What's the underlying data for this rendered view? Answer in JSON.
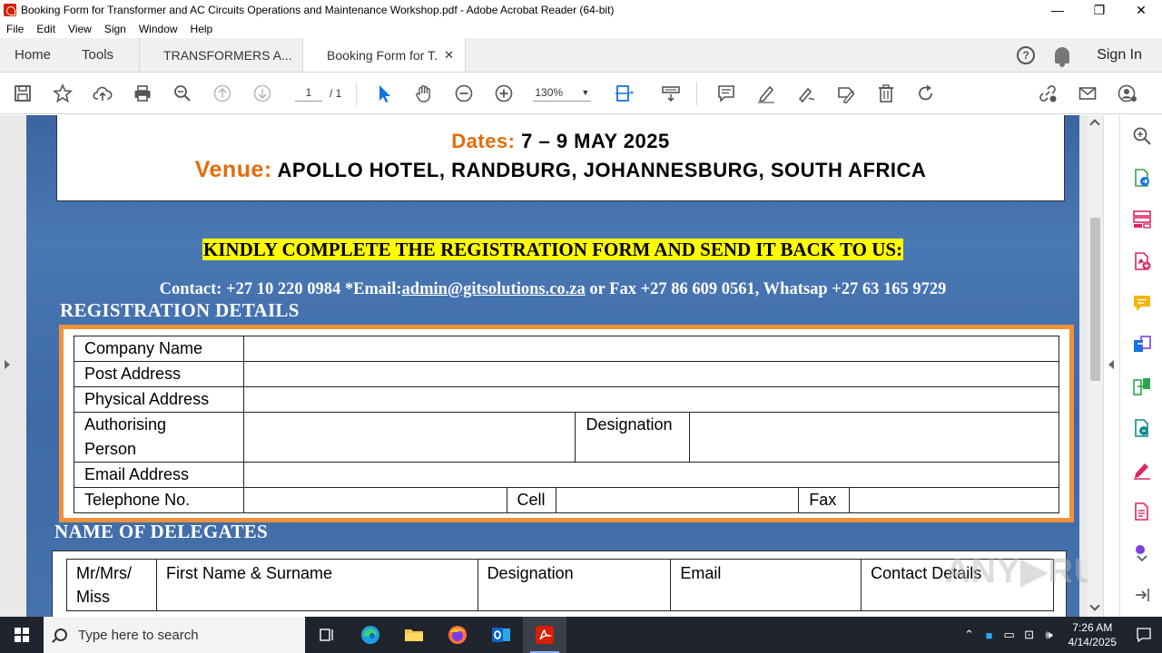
{
  "window": {
    "title": "Booking Form for Transformer and AC Circuits Operations and Maintenance Workshop.pdf - Adobe Acrobat Reader (64-bit)",
    "min": "—",
    "max": "❐",
    "close": "✕"
  },
  "menu": [
    "File",
    "Edit",
    "View",
    "Sign",
    "Window",
    "Help"
  ],
  "tabs": {
    "home": "Home",
    "tools": "Tools",
    "doc1": "TRANSFORMERS A...",
    "doc2": "Booking Form for T...",
    "close": "✕",
    "help": "?",
    "signin": "Sign In"
  },
  "toolbar": {
    "page_current": "1",
    "page_total": "/  1",
    "zoom": "130%"
  },
  "document": {
    "dates_label": "Dates:",
    "dates_value": "7 – 9 MAY 2025",
    "venue_label": "Venue:",
    "venue_value": "APOLLO HOTEL, RANDBURG, JOHANNESBURG, SOUTH AFRICA",
    "kindly": "KINDLY COMPLETE THE REGISTRATION FORM AND SEND IT BACK TO US:",
    "contact_prefix": "Contact: +27 10 220 0984 *Email:",
    "contact_email": "admin@gitsolutions.co.za",
    "contact_suffix": " or Fax +27 86 609 0561, Whatsap +27 63 165 9729",
    "reg_title": "REGISTRATION DETAILS",
    "reg": {
      "company": "Company Name",
      "post": "Post Address",
      "physical": "Physical Address",
      "auth_1": "Authorising",
      "auth_2": "Person",
      "designation": "Designation",
      "email": "Email Address",
      "telephone": "Telephone No.",
      "cell": "Cell",
      "fax": "Fax"
    },
    "delegates_title": "NAME OF DELEGATES",
    "delegates_headers": {
      "title_1": "Mr/Mrs/",
      "title_2": "Miss",
      "name": "First Name & Surname",
      "designation": "Designation",
      "email": "Email",
      "contact": "Contact Details"
    }
  },
  "taskbar": {
    "search_placeholder": "Type here to search",
    "time": "7:26 AM",
    "date": "4/14/2025"
  },
  "colors": {
    "accent_orange": "#e36c0a",
    "highlight_yellow": "#ffff00",
    "page_blue": "#3d6aa6"
  }
}
